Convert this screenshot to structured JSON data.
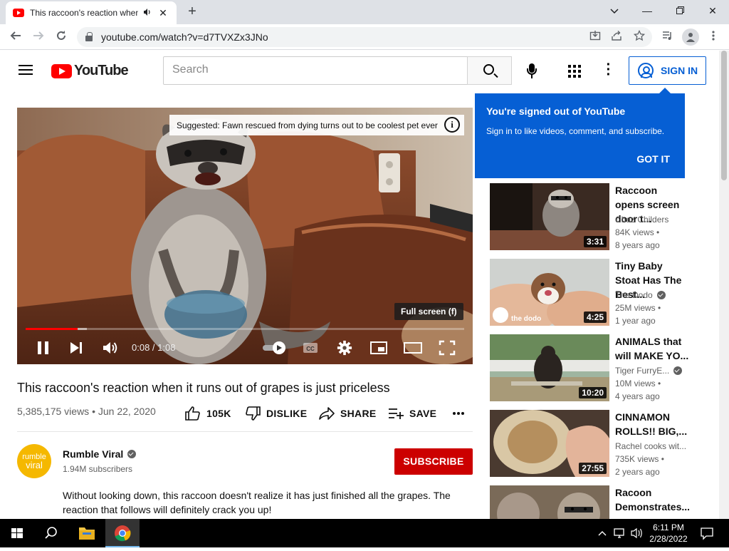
{
  "browser": {
    "tab_title": "This raccoon's reaction when",
    "url": "youtube.com/watch?v=d7TVXZx3JNo"
  },
  "yt": {
    "logo_text": "YouTube",
    "search_placeholder": "Search",
    "signin_label": "SIGN IN"
  },
  "popup": {
    "heading": "You're signed out of YouTube",
    "body": "Sign in to like videos, comment, and subscribe.",
    "got_it": "GOT IT"
  },
  "player": {
    "suggested": "Suggested: Fawn rescued from dying turns out to be coolest pet ever",
    "info_glyph": "i",
    "fullscreen_tip": "Full screen (f)",
    "time": "0:08 / 1:08",
    "played_fraction": 0.118,
    "loaded_fraction": 0.14
  },
  "video": {
    "title": "This raccoon's reaction when it runs out of grapes is just priceless",
    "meta": "5,385,175 views • Jun 22, 2020",
    "likes": "105K",
    "dislike_label": "DISLIKE",
    "share_label": "SHARE",
    "save_label": "SAVE"
  },
  "channel": {
    "avatar_top": "rumble",
    "avatar_bottom": "viral",
    "name": "Rumble Viral",
    "subscribers": "1.94M subscribers",
    "subscribe_label": "SUBSCRIBE",
    "description": "Without looking down, this raccoon doesn't realize it has just finished all the grapes. The reaction that follows will definitely crack you up!"
  },
  "recommendations": [
    {
      "title": "Raccoon opens screen door t...",
      "channel": "Chaz Childers",
      "verified": false,
      "views": "84K views •",
      "age": "8 years ago",
      "duration": "3:31"
    },
    {
      "title": "Tiny Baby Stoat Has The Best...",
      "channel": "The Dodo",
      "verified": true,
      "views": "25M views •",
      "age": "1 year ago",
      "duration": "4:25",
      "badge": "the dodo"
    },
    {
      "title": "ANIMALS that will MAKE YO...",
      "channel": "Tiger FurryE...",
      "verified": true,
      "views": "10M views •",
      "age": "4 years ago",
      "duration": "10:20"
    },
    {
      "title": "CINNAMON ROLLS!! BIG,...",
      "channel": "Rachel cooks wit...",
      "verified": false,
      "views": "735K views •",
      "age": "2 years ago",
      "duration": "27:55"
    },
    {
      "title": "Racoon Demonstrates...",
      "channel": "",
      "verified": false,
      "views": "",
      "age": "",
      "duration": ""
    }
  ],
  "taskbar": {
    "time": "6:11 PM",
    "date": "2/28/2022"
  }
}
